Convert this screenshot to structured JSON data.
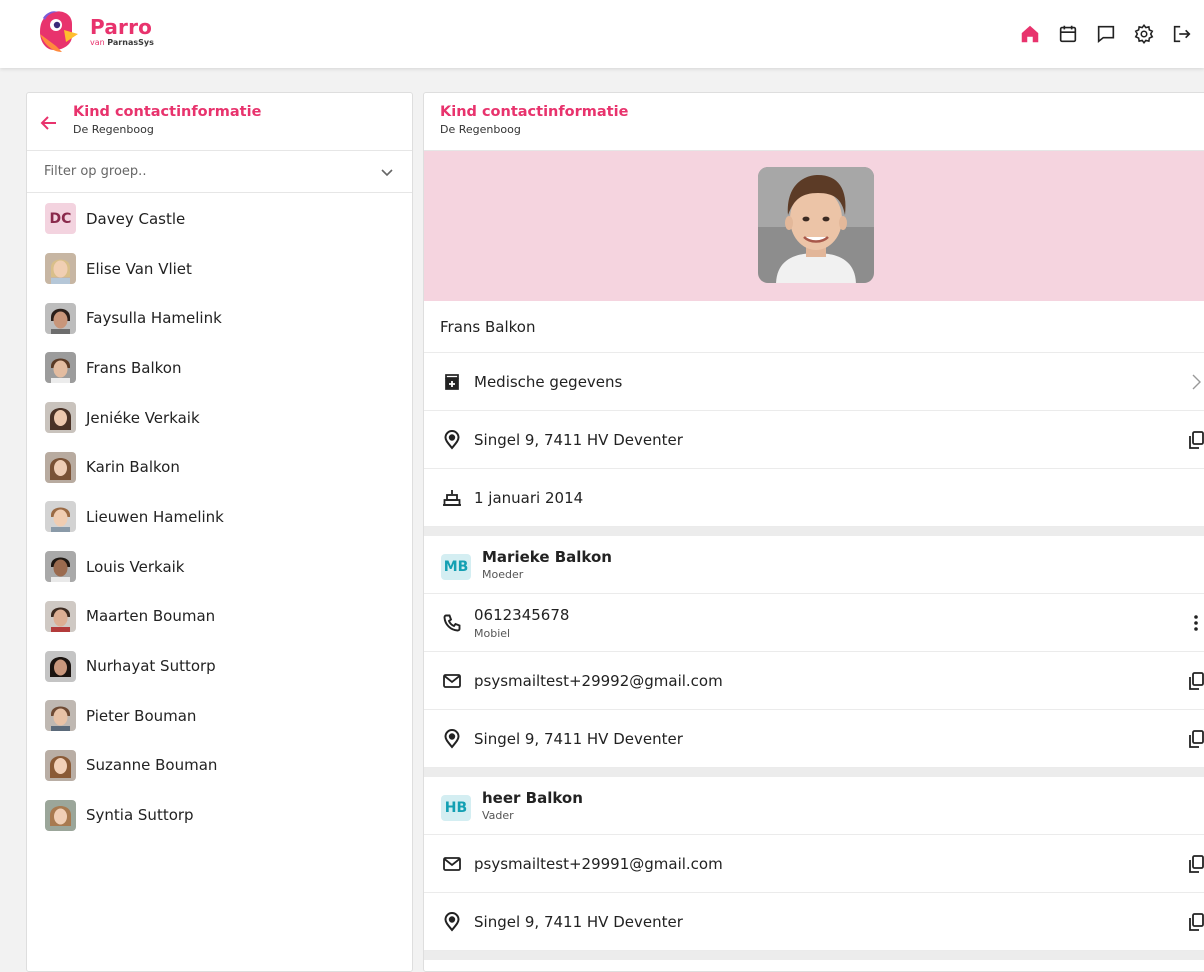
{
  "app": {
    "name": "Parro",
    "sub_prefix": "van ",
    "sub_brand": "ParnasSys"
  },
  "left_panel": {
    "title": "Kind contactinformatie",
    "subtitle": "De Regenboog",
    "filter_placeholder": "Filter op groep..",
    "children": [
      {
        "name": "Davey Castle",
        "initials": "DC"
      },
      {
        "name": "Elise Van Vliet"
      },
      {
        "name": "Faysulla Hamelink"
      },
      {
        "name": "Frans Balkon"
      },
      {
        "name": "Jeniéke Verkaik"
      },
      {
        "name": "Karin Balkon"
      },
      {
        "name": "Lieuwen Hamelink"
      },
      {
        "name": "Louis Verkaik"
      },
      {
        "name": "Maarten Bouman"
      },
      {
        "name": "Nurhayat Suttorp"
      },
      {
        "name": "Pieter Bouman"
      },
      {
        "name": "Suzanne Bouman"
      },
      {
        "name": "Syntia Suttorp"
      }
    ]
  },
  "right_panel": {
    "title": "Kind contactinformatie",
    "subtitle": "De Regenboog",
    "child_name": "Frans Balkon",
    "medical_label": "Medische gegevens",
    "address": "Singel 9, 7411 HV  Deventer",
    "birthdate": "1 januari 2014",
    "contacts": [
      {
        "initials": "MB",
        "name": "Marieke Balkon",
        "role": "Moeder",
        "phone": "0612345678",
        "phone_type": "Mobiel",
        "email": "psysmailtest+29992@gmail.com",
        "address": "Singel 9, 7411 HV  Deventer"
      },
      {
        "initials": "HB",
        "name": "heer Balkon",
        "role": "Vader",
        "email": "psysmailtest+29991@gmail.com",
        "address": "Singel 9, 7411 HV  Deventer"
      }
    ]
  },
  "colors": {
    "accent": "#e8336d",
    "photo_band": "#f5d4df",
    "badge_bg": "#d4eef2",
    "badge_text": "#14a0b3"
  }
}
